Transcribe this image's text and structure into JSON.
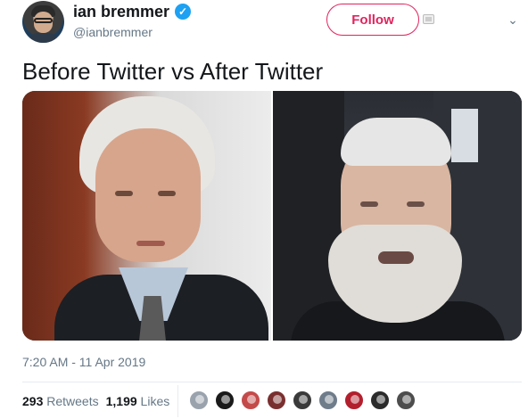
{
  "profile": {
    "name": "ian bremmer",
    "handle": "@ianbremmer",
    "verified_glyph": "✓"
  },
  "actions": {
    "follow_label": "Follow",
    "menu_glyph": "⌄"
  },
  "tweet": {
    "text": "Before Twitter vs After Twitter",
    "timestamp": "7:20 AM - 11 Apr 2019"
  },
  "stats": {
    "retweets_count": "293",
    "retweets_label": "Retweets",
    "likes_count": "1,199",
    "likes_label": "Likes"
  },
  "colors": {
    "follow_accent": "#e0245e",
    "verified_blue": "#1da1f2",
    "secondary_text": "#657786"
  },
  "likers": [
    {
      "color": "#9aa3ad"
    },
    {
      "color": "#1a1a1a"
    },
    {
      "color": "#c44a4a"
    },
    {
      "color": "#7a2f2f"
    },
    {
      "color": "#3a3a3a"
    },
    {
      "color": "#6f7c8a"
    },
    {
      "color": "#b21f2d"
    },
    {
      "color": "#2b2b2b"
    },
    {
      "color": "#4d4d4d"
    }
  ]
}
